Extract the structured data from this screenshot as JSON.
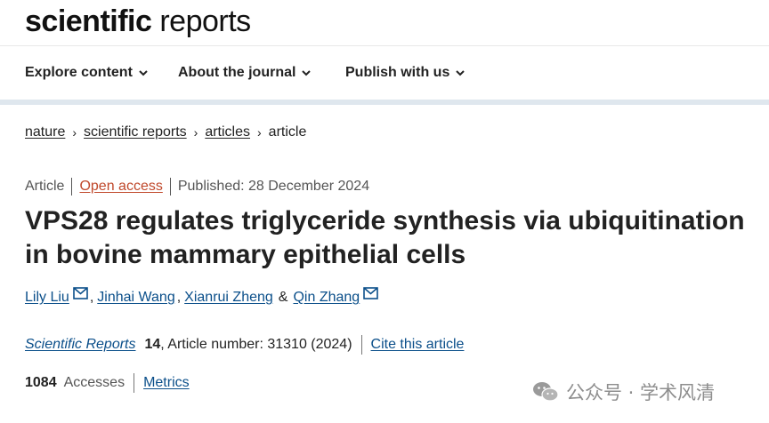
{
  "masthead": {
    "logo_bold": "scientific",
    "logo_light": " reports"
  },
  "nav": {
    "items": [
      {
        "label": "Explore content"
      },
      {
        "label": "About the journal"
      },
      {
        "label": "Publish with us"
      }
    ]
  },
  "breadcrumb": {
    "items": [
      "nature",
      "scientific reports",
      "articles",
      "article"
    ],
    "separator": "›"
  },
  "meta": {
    "type": "Article",
    "access": "Open access",
    "published": "Published: 28 December 2024"
  },
  "article": {
    "title": "VPS28 regulates triglyceride synthesis via ubiquitination in bovine mammary epithelial cells"
  },
  "authors": {
    "list": [
      "Lily Liu",
      "Jinhai Wang",
      "Xianrui Zheng",
      "Qin Zhang"
    ],
    "comma": ",",
    "ampersand": "&"
  },
  "citation": {
    "journal": "Scientific Reports",
    "volume": "14",
    "article_number": ", Article number: 31310 (2024)",
    "cite_label": "Cite this article"
  },
  "stats": {
    "accesses": "1084",
    "accesses_label": "Accesses",
    "metrics_label": "Metrics"
  },
  "watermark": {
    "text": "公众号 · 学术风清"
  },
  "colors": {
    "link": "#0b4f8a",
    "open_access": "#c0492c",
    "divider": "#dfe7ee"
  }
}
